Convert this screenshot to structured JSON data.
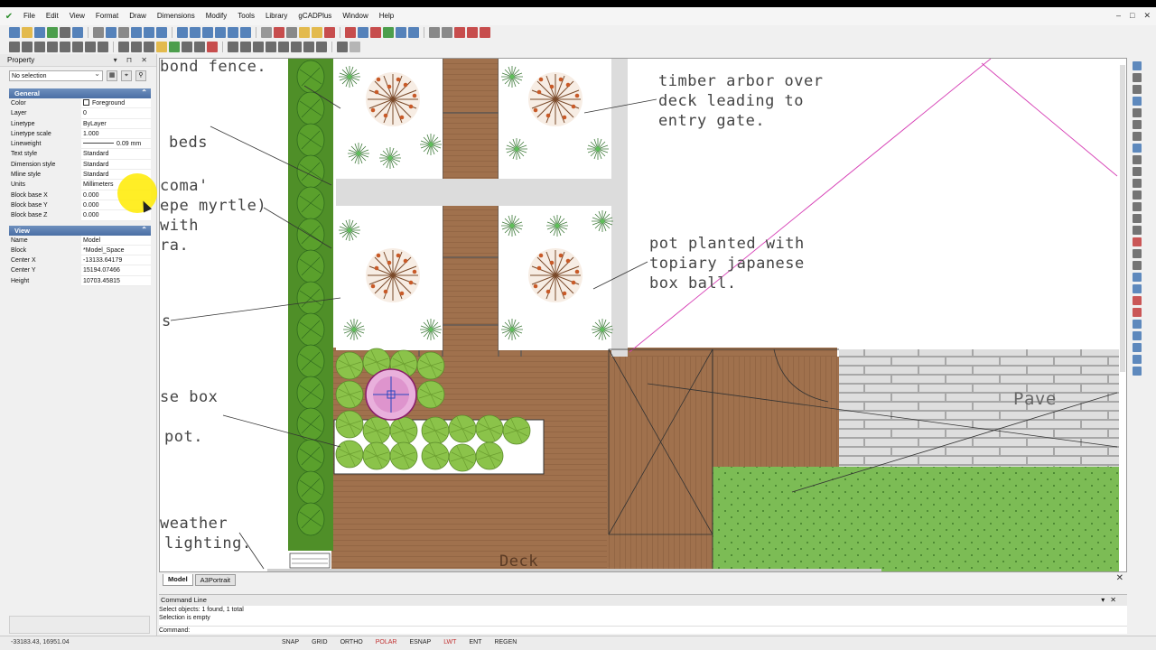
{
  "menu": [
    "File",
    "Edit",
    "View",
    "Format",
    "Draw",
    "Dimensions",
    "Modify",
    "Tools",
    "Library",
    "gCADPlus",
    "Window",
    "Help"
  ],
  "window_controls": [
    "–",
    "□",
    "✕"
  ],
  "toolbar_colors": {
    "row1": [
      "#3a6fb0",
      "#e0b030",
      "#3a6fb0",
      "#2f8f2f",
      "#555",
      "#3a6fb0",
      "#777",
      "#3a6fb0",
      "#777",
      "#3a6fb0",
      "#3a6fb0",
      "#3a6fb0",
      "#3a6fb0",
      "#3a6fb0",
      "#3a6fb0",
      "#3a6fb0",
      "#3a6fb0",
      "#3a6fb0",
      "#888",
      "#c03030",
      "#777",
      "#e0b030",
      "#e0b030",
      "#c03030",
      "#c03030",
      "#3a6fb0",
      "#c03030",
      "#2f8f2f",
      "#3a6fb0",
      "#3a6fb0",
      "#777",
      "#777",
      "#c03030",
      "#c03030",
      "#c03030"
    ],
    "row2": [
      "#555",
      "#555",
      "#555",
      "#555",
      "#555",
      "#555",
      "#555",
      "#555",
      "#555",
      "#555",
      "#555",
      "#e0b030",
      "#2f8f2f",
      "#555",
      "#555",
      "#c03030",
      "#555",
      "#555",
      "#555",
      "#555",
      "#555",
      "#555",
      "#555",
      "#555",
      "#555",
      "#aaa"
    ]
  },
  "property_panel": {
    "title": "Property",
    "selection": "No selection",
    "general": {
      "header": "General",
      "rows": [
        {
          "key": "Color",
          "value": "Foreground"
        },
        {
          "key": "Layer",
          "value": "0"
        },
        {
          "key": "Linetype",
          "value": "ByLayer"
        },
        {
          "key": "Linetype scale",
          "value": "1.000"
        },
        {
          "key": "Lineweight",
          "value": "0.09 mm"
        },
        {
          "key": "Text style",
          "value": "Standard"
        },
        {
          "key": "Dimension style",
          "value": "Standard"
        },
        {
          "key": "Mline style",
          "value": "Standard"
        },
        {
          "key": "Units",
          "value": "Millimeters"
        },
        {
          "key": "Block base X",
          "value": "0.000"
        },
        {
          "key": "Block base Y",
          "value": "0.000"
        },
        {
          "key": "Block base Z",
          "value": "0.000"
        }
      ]
    },
    "view": {
      "header": "View",
      "rows": [
        {
          "key": "Name",
          "value": "Model"
        },
        {
          "key": "Block",
          "value": "*Model_Space"
        },
        {
          "key": "Center X",
          "value": "-13133.64179"
        },
        {
          "key": "Center Y",
          "value": "15194.07466"
        },
        {
          "key": "Height",
          "value": "10703.45815"
        }
      ]
    }
  },
  "drawing_labels": {
    "bond_fence": "bond fence.",
    "beds": "beds",
    "coma": "coma'",
    "crepe_myrtle": "epe myrtle)",
    "with": "with",
    "ra": "ra.",
    "s": "s",
    "se_box": "se box",
    "pot": "pot.",
    "weather": "weather",
    "lighting": "lighting.",
    "deck": "Deck",
    "arbor_1": "timber arbor over",
    "arbor_2": "deck leading to",
    "arbor_3": "entry gate.",
    "topiary_1": "pot planted with",
    "topiary_2": "topiary japanese",
    "topiary_3": "box ball.",
    "pave": "Pave"
  },
  "drawing_colors": {
    "deck": "#a0714d",
    "hedge": "#5aa02c",
    "lawn": "#7cbc55",
    "pavers": "#dedede",
    "arbor_line": "#d63fb5",
    "leaf": "#8bc34a"
  },
  "tabs": [
    "Model",
    "A3Portrait"
  ],
  "command_line": {
    "title": "Command Line",
    "lines": [
      "Select objects: 1 found,  1 total",
      "Selection is empty"
    ],
    "prompt": "Command:"
  },
  "status_bar": {
    "coords": "-33183.43, 16951.04",
    "toggles": [
      {
        "label": "SNAP",
        "on": false
      },
      {
        "label": "GRID",
        "on": false
      },
      {
        "label": "ORTHO",
        "on": false
      },
      {
        "label": "POLAR",
        "on": true
      },
      {
        "label": "ESNAP",
        "on": false
      },
      {
        "label": "LWT",
        "on": true
      },
      {
        "label": "ENT",
        "on": false
      },
      {
        "label": "REGEN",
        "on": false
      }
    ]
  },
  "right_toolbar_colors": [
    "#3a6fb0",
    "#555",
    "#555",
    "#3a6fb0",
    "#555",
    "#555",
    "#555",
    "#3a6fb0",
    "#555",
    "#555",
    "#555",
    "#555",
    "#555",
    "#555",
    "#555",
    "#c03030",
    "#555",
    "#555",
    "#3a6fb0",
    "#3a6fb0",
    "#c03030",
    "#c03030",
    "#3a6fb0",
    "#3a6fb0",
    "#3a6fb0",
    "#3a6fb0",
    "#3a6fb0"
  ]
}
